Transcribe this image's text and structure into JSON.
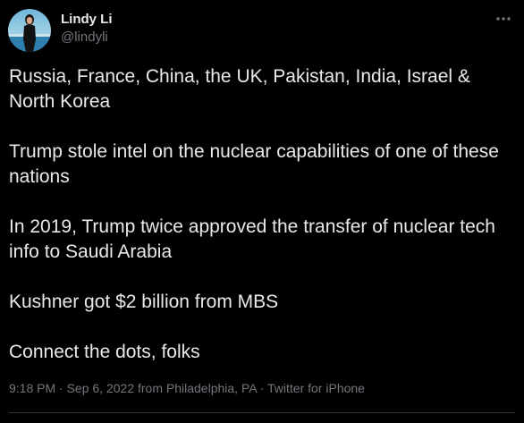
{
  "tweet": {
    "author": {
      "display_name": "Lindy Li",
      "handle": "@lindyli",
      "avatar": "profile-photo"
    },
    "more_icon": "more-horizontal-icon",
    "paragraphs": [
      "Russia, France, China, the UK, Pakistan, India, Israel & North Korea",
      "Trump stole intel on the nuclear capabilities of one of these nations",
      "In 2019, Trump twice approved the transfer of nuclear tech info to Saudi Arabia",
      "Kushner got $2 billion from MBS",
      "Connect the dots, folks"
    ],
    "meta": {
      "time": "9:18 PM",
      "separator": "·",
      "date": "Sep 6, 2022",
      "location": "from Philadelphia, PA",
      "source": "Twitter for iPhone"
    }
  },
  "colors": {
    "background": "#000000",
    "text_primary": "#e7e9ea",
    "text_secondary": "#71767b",
    "divider": "#2f3336"
  }
}
